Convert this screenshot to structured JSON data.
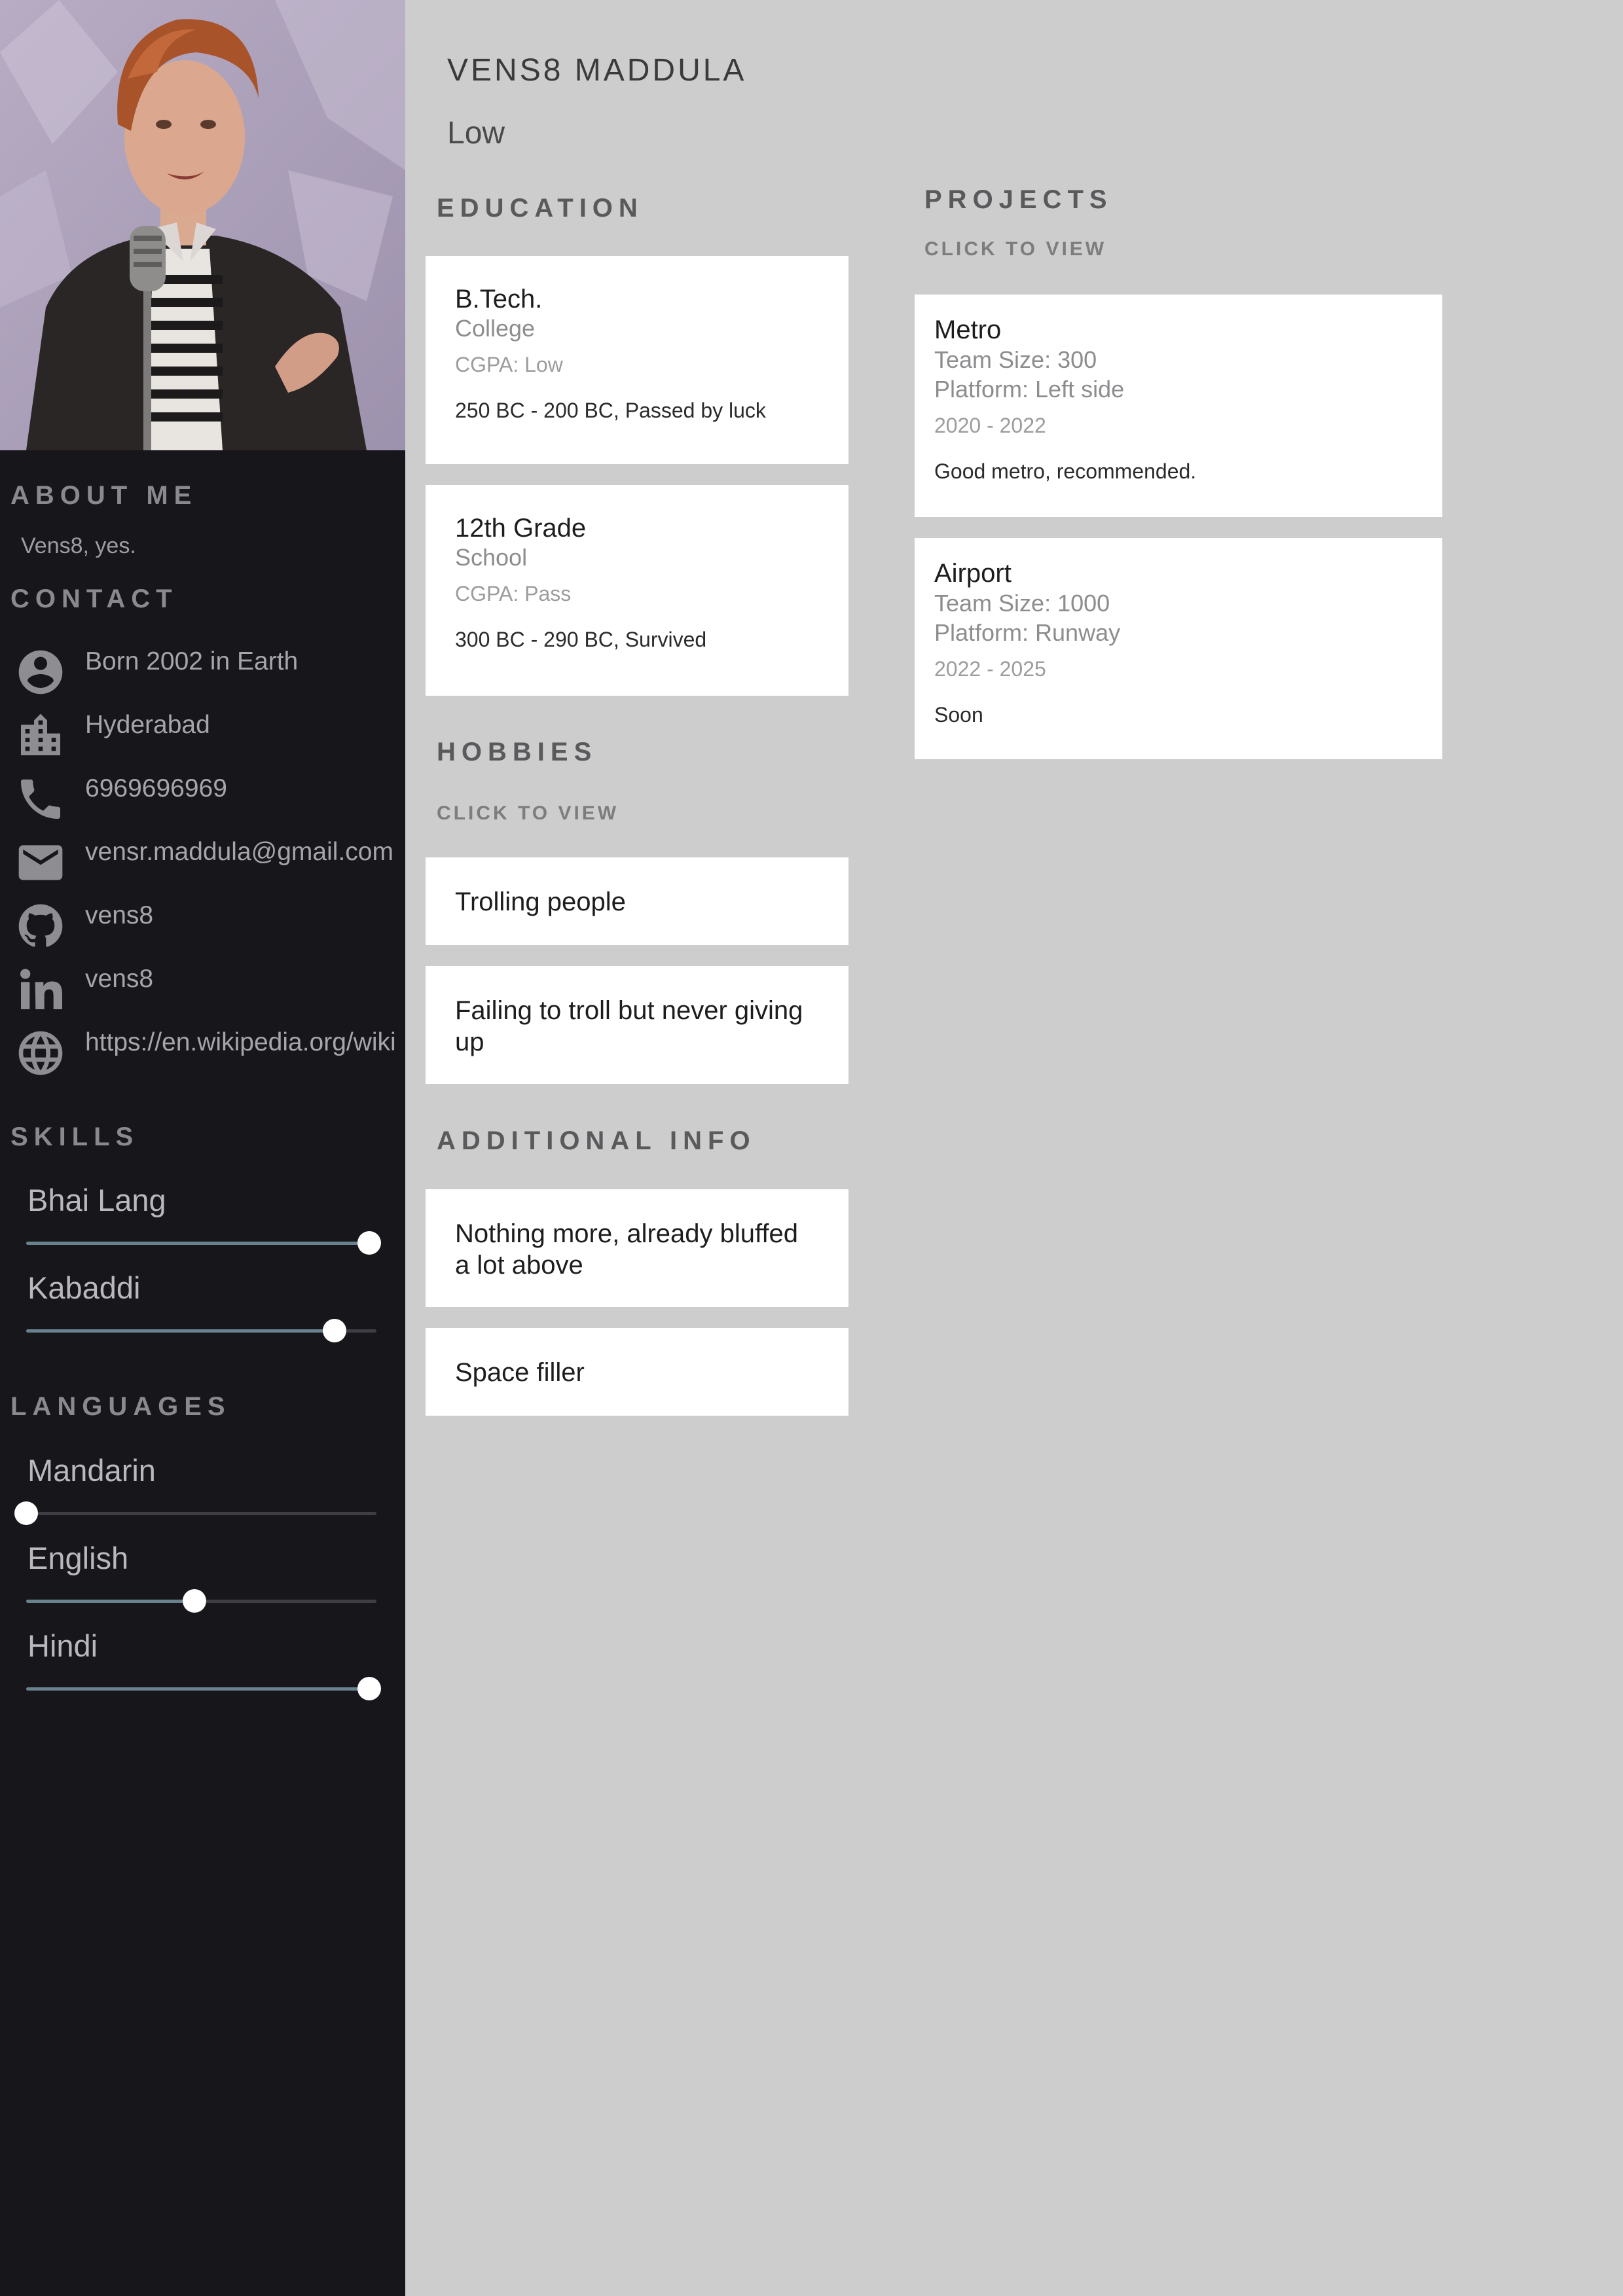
{
  "profile": {
    "name": "VENS8 MADDULA",
    "subtitle": "Low"
  },
  "sidebar": {
    "about_heading": "ABOUT ME",
    "about_text": "Vens8, yes.",
    "contact_heading": "CONTACT",
    "contacts": [
      {
        "icon": "account-circle-icon",
        "text": "Born 2002 in Earth"
      },
      {
        "icon": "building-icon",
        "text": "Hyderabad"
      },
      {
        "icon": "phone-icon",
        "text": "6969696969"
      },
      {
        "icon": "email-icon",
        "text": "vensr.maddula@gmail.com"
      },
      {
        "icon": "github-icon",
        "text": "vens8"
      },
      {
        "icon": "linkedin-icon",
        "text": "vens8"
      },
      {
        "icon": "globe-icon",
        "text": "https://en.wikipedia.org/wiki"
      }
    ],
    "skills_heading": "SKILLS",
    "skills": [
      {
        "label": "Bhai Lang",
        "level": 0.98
      },
      {
        "label": "Kabaddi",
        "level": 0.88
      }
    ],
    "languages_heading": "LANGUAGES",
    "languages": [
      {
        "label": "Mandarin",
        "level": 0.0
      },
      {
        "label": "English",
        "level": 0.48
      },
      {
        "label": "Hindi",
        "level": 0.98
      }
    ]
  },
  "education": {
    "heading": "EDUCATION",
    "items": [
      {
        "title": "B.Tech.",
        "subtitle": "College",
        "grade": "CGPA: Low",
        "description": "250 BC - 200 BC, Passed by luck"
      },
      {
        "title": "12th Grade",
        "subtitle": "School",
        "grade": "CGPA: Pass",
        "description": "300 BC - 290 BC, Survived"
      }
    ]
  },
  "hobbies": {
    "heading": "HOBBIES",
    "click_label": "CLICK TO VIEW",
    "items": [
      "Trolling people",
      "Failing to troll but never giving up"
    ]
  },
  "additional": {
    "heading": "ADDITIONAL INFO",
    "items": [
      "Nothing more, already bluffed a lot above",
      "Space filler"
    ]
  },
  "projects": {
    "heading": "PROJECTS",
    "click_label": "CLICK TO VIEW",
    "items": [
      {
        "title": "Metro",
        "team": "Team Size: 300",
        "platform": "Platform: Left side",
        "dates": "2020 - 2022",
        "description": "Good metro, recommended."
      },
      {
        "title": "Airport",
        "team": "Team Size: 1000",
        "platform": "Platform: Runway",
        "dates": "2022 - 2025",
        "description": "Soon"
      }
    ]
  },
  "colors": {
    "sidebar_bg": "#16161b",
    "main_bg": "#cdcdcd",
    "card_bg": "#ffffff",
    "slider_fill": "#6a818e",
    "slider_track": "#3e3e44"
  }
}
